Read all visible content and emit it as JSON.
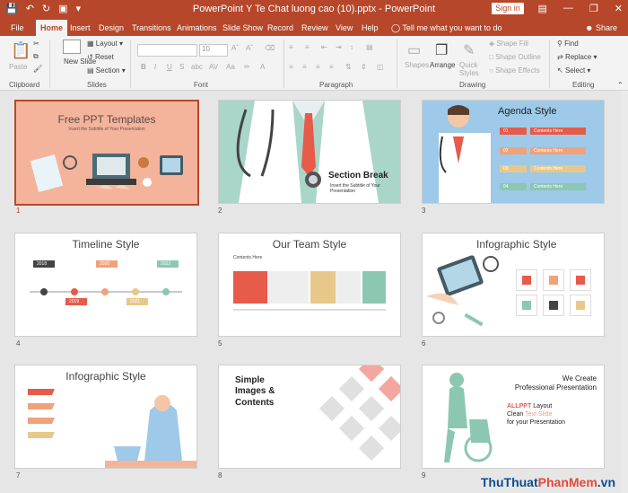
{
  "window": {
    "title": "PowerPoint Y Te Chat luong cao (10).pptx  -  PowerPoint",
    "sign_in": "Sign in",
    "accent": "#b7472a"
  },
  "tabs": [
    "File",
    "Home",
    "Insert",
    "Design",
    "Transitions",
    "Animations",
    "Slide Show",
    "Record",
    "Review",
    "View",
    "Help"
  ],
  "tell_me": "Tell me what you want to do",
  "share": "Share",
  "ribbon": {
    "clipboard": {
      "paste": "Paste",
      "label": "Clipboard"
    },
    "slides": {
      "new_slide": "New Slide",
      "layout": "Layout",
      "reset": "Reset",
      "section": "Section",
      "label": "Slides"
    },
    "font": {
      "size": "10",
      "label": "Font",
      "bold": "B",
      "italic": "I",
      "underline": "U",
      "strike": "S",
      "shadow": "abc",
      "spacing": "AV",
      "case": "Aa"
    },
    "paragraph": {
      "label": "Paragraph"
    },
    "drawing": {
      "shapes": "Shapes",
      "arrange": "Arrange",
      "quick_styles": "Quick Styles",
      "shape_fill": "Shape Fill",
      "shape_outline": "Shape Outline",
      "shape_effects": "Shape Effects",
      "label": "Drawing"
    },
    "editing": {
      "find": "Find",
      "replace": "Replace",
      "select": "Select",
      "label": "Editing"
    }
  },
  "slides": [
    {
      "num": "1",
      "title": "Free PPT Templates",
      "subtitle": "Insert the Subtitle of Your Presentation"
    },
    {
      "num": "2",
      "title": "Section Break",
      "subtitle": "Insert the Subtitle of Your Presentation"
    },
    {
      "num": "3",
      "title": "Agenda Style",
      "items": [
        "01",
        "02",
        "03",
        "04"
      ],
      "item_label": "Contents Here"
    },
    {
      "num": "4",
      "title": "Timeline Style",
      "years": [
        "2018",
        "2019",
        "2020",
        "2021",
        "2022"
      ]
    },
    {
      "num": "5",
      "title": "Our Team Style",
      "contents": "Contents Here"
    },
    {
      "num": "6",
      "title": "Infographic Style"
    },
    {
      "num": "7",
      "title": "Infographic Style"
    },
    {
      "num": "8",
      "title_lines": [
        "Simple",
        "Images &",
        "Contents"
      ]
    },
    {
      "num": "9",
      "title_lines": [
        "We Create",
        "Professional Presentation"
      ],
      "brand": "ALLPPT",
      "layout_word": "Layout",
      "clean": "Clean",
      "text_slide": "Text Slide",
      "for_line": "for your Presentation"
    }
  ],
  "watermark": {
    "part1": "ThuThuat",
    "part2": "PhanMem",
    "part3": ".vn"
  }
}
